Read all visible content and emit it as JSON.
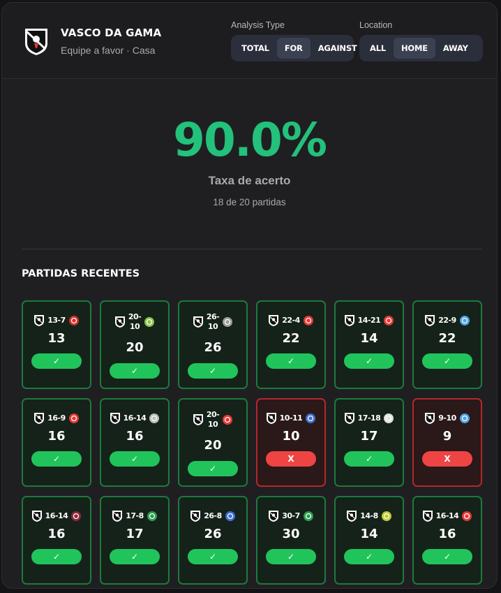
{
  "header": {
    "team_name": "VASCO DA GAMA",
    "subtitle": "Equipe a favor · Casa",
    "team_icon": "vasco-crest-icon"
  },
  "analysis_type": {
    "label": "Analysis Type",
    "options": [
      "TOTAL",
      "FOR",
      "AGAINST"
    ],
    "selected": "FOR"
  },
  "location": {
    "label": "Location",
    "options": [
      "ALL",
      "HOME",
      "AWAY"
    ],
    "selected": "HOME"
  },
  "summary": {
    "percentage": "90.0%",
    "label": "Taxa de acerto",
    "detail": "18 de 20 partidas",
    "accent": "#23c17b"
  },
  "recent": {
    "title": "PARTIDAS RECENTES",
    "matches": [
      {
        "score": "13-7",
        "value": "13",
        "result": "✓",
        "hit": true,
        "opp_icon": "medellin-crest-icon",
        "opp_color": "#d32f2f"
      },
      {
        "score": "20-10",
        "value": "20",
        "result": "✓",
        "hit": true,
        "opp_icon": "mirassol-crest-icon",
        "opp_color": "#8bc34a"
      },
      {
        "score": "26-10",
        "value": "26",
        "result": "✓",
        "hit": true,
        "opp_icon": "atletico-mg-crest-icon",
        "opp_color": "#9e9e9e"
      },
      {
        "score": "22-4",
        "value": "22",
        "result": "✓",
        "hit": true,
        "opp_icon": "bragantino-crest-icon",
        "opp_color": "#e53935"
      },
      {
        "score": "14-21",
        "value": "14",
        "result": "✓",
        "hit": true,
        "opp_icon": "redbull-crest-icon",
        "opp_color": "#e53935"
      },
      {
        "score": "22-9",
        "value": "22",
        "result": "✓",
        "hit": true,
        "opp_icon": "paysandu-crest-icon",
        "opp_color": "#4fa3e0"
      },
      {
        "score": "16-9",
        "value": "16",
        "result": "✓",
        "hit": true,
        "opp_icon": "athletico-pr-crest-icon",
        "opp_color": "#e53935"
      },
      {
        "score": "16-14",
        "value": "16",
        "result": "✓",
        "hit": true,
        "opp_icon": "corinthians-crest-icon",
        "opp_color": "#bdbdbd"
      },
      {
        "score": "20-10",
        "value": "20",
        "result": "✓",
        "hit": true,
        "opp_icon": "sao-paulo-crest-icon",
        "opp_color": "#e53935"
      },
      {
        "score": "10-11",
        "value": "10",
        "result": "X",
        "hit": false,
        "opp_icon": "cruzeiro-crest-icon",
        "opp_color": "#3f6fd1"
      },
      {
        "score": "17-18",
        "value": "17",
        "result": "✓",
        "hit": true,
        "opp_icon": "botafogo-crest-icon",
        "opp_color": "#e0e0e0"
      },
      {
        "score": "9-10",
        "value": "9",
        "result": "X",
        "hit": false,
        "opp_icon": "gremio-crest-icon",
        "opp_color": "#4fa3e0"
      },
      {
        "score": "16-14",
        "value": "16",
        "result": "✓",
        "hit": true,
        "opp_icon": "fluminense-crest-icon",
        "opp_color": "#8e2a3a"
      },
      {
        "score": "17-8",
        "value": "17",
        "result": "✓",
        "hit": true,
        "opp_icon": "palmeiras-crest-icon",
        "opp_color": "#2e9d4f"
      },
      {
        "score": "26-8",
        "value": "26",
        "result": "✓",
        "hit": true,
        "opp_icon": "bahia-crest-icon",
        "opp_color": "#3f6fd1"
      },
      {
        "score": "30-7",
        "value": "30",
        "result": "✓",
        "hit": true,
        "opp_icon": "chapecoense-crest-icon",
        "opp_color": "#2e9d4f"
      },
      {
        "score": "14-8",
        "value": "14",
        "result": "✓",
        "hit": true,
        "opp_icon": "mirassol-crest-icon",
        "opp_color": "#c0ca33"
      },
      {
        "score": "16-14",
        "value": "16",
        "result": "✓",
        "hit": true,
        "opp_icon": "internacional-crest-icon",
        "opp_color": "#e53935"
      }
    ]
  }
}
